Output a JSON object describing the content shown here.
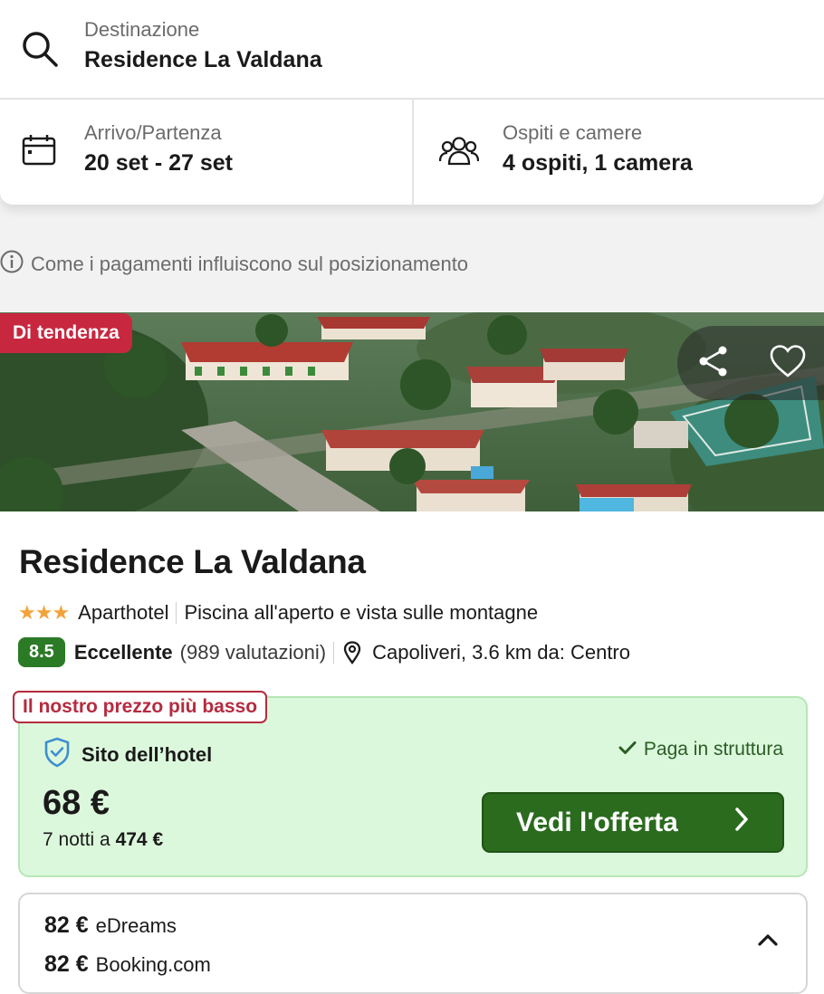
{
  "search": {
    "destination_label": "Destinazione",
    "destination_value": "Residence La Valdana",
    "dates_label": "Arrivo/Partenza",
    "dates_value": "20 set - 27 set",
    "guests_label": "Ospiti e camere",
    "guests_value": "4 ospiti, 1 camera"
  },
  "info_line": "Come i pagamenti influiscono sul posizionamento",
  "hotel": {
    "badge": "Di tendenza",
    "name": "Residence La Valdana",
    "stars": "★★★",
    "type": "Aparthotel",
    "features": "Piscina all'aperto e vista sulle montagne",
    "score": "8.5",
    "rating_word": "Eccellente",
    "rating_count": "(989 valutazioni)",
    "location": "Capoliveri, 3.6 km da: Centro"
  },
  "deal": {
    "tag": "Il nostro prezzo più basso",
    "site": "Sito dell’hotel",
    "pay": "Paga in struttura",
    "price": "68 €",
    "nights_prefix": "7 notti a",
    "nights_total": "474 €",
    "cta": "Vedi l'offerta"
  },
  "others": [
    {
      "price": "82 €",
      "provider": "eDreams"
    },
    {
      "price": "82 €",
      "provider": "Booking.com"
    }
  ],
  "colors": {
    "badge_red": "#c7283f",
    "score_green": "#2b7a26",
    "deal_bg": "#dcf8dc",
    "cta_green": "#2a6b1e"
  }
}
